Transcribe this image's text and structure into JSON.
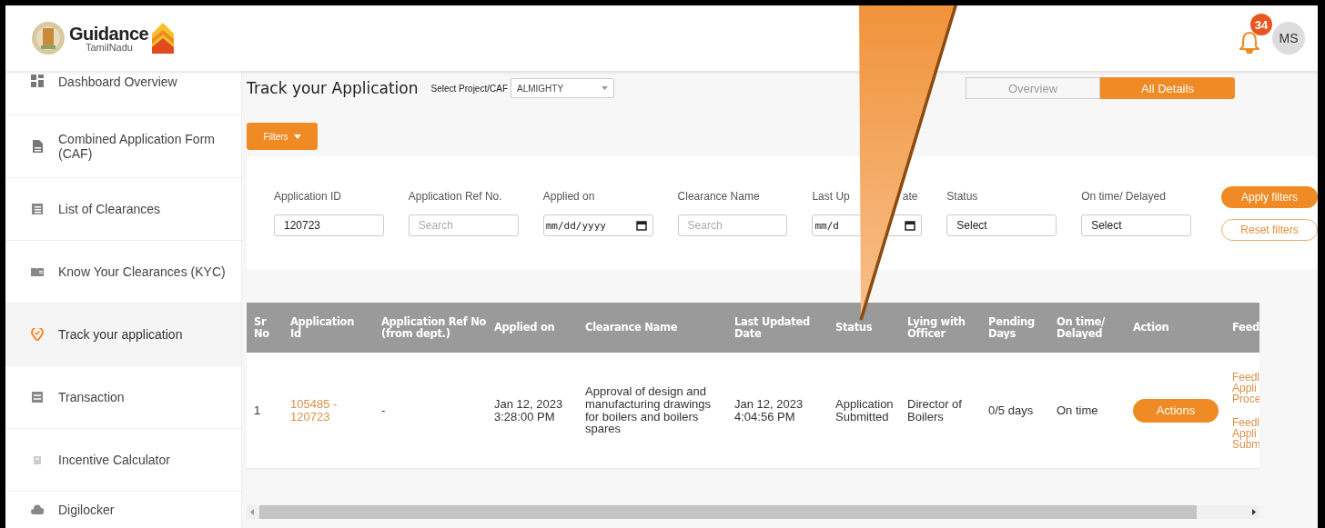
{
  "header": {
    "brand": "Guidance",
    "tagline": "TamilNadu",
    "notifications": "34",
    "avatar": "MS"
  },
  "sidebar": {
    "items": [
      {
        "label": "Dashboard Overview",
        "selected": false
      },
      {
        "label": "Combined Application Form (CAF)",
        "selected": false
      },
      {
        "label": "List of Clearances",
        "selected": false
      },
      {
        "label": "Know Your Clearances (KYC)",
        "selected": false
      },
      {
        "label": "Track your application",
        "selected": true
      },
      {
        "label": "Transaction",
        "selected": false
      },
      {
        "label": "Incentive Calculator",
        "selected": false
      },
      {
        "label": "Digilocker",
        "selected": false
      }
    ]
  },
  "page": {
    "title": "Track your Application",
    "project_select": {
      "label": "Select Project/CAF",
      "value": "ALMIGHTY"
    },
    "view_tabs": [
      {
        "label": "Overview",
        "selected": false
      },
      {
        "label": "All Details",
        "selected": true
      }
    ],
    "filters_button": "Filters",
    "filters": [
      {
        "kind": "text",
        "label": "Application ID",
        "value": "120723"
      },
      {
        "kind": "text",
        "label": "Application Ref No.",
        "placeholder": "Search"
      },
      {
        "kind": "date",
        "label": "Applied on",
        "placeholder": "mm/dd/yyyy"
      },
      {
        "kind": "text",
        "label": "Clearance Name",
        "placeholder": "Search"
      },
      {
        "kind": "date",
        "label_parts": [
          "Last Up",
          "ate"
        ],
        "placeholder": "mm/d"
      },
      {
        "kind": "select",
        "label": "Status",
        "value": "Select"
      },
      {
        "kind": "select",
        "label": "On time/ Delayed",
        "value": "Select"
      }
    ],
    "apply_button": "Apply filters",
    "reset_button": "Reset filters"
  },
  "table": {
    "columns": [
      "Sr No",
      "Application Id",
      "Application Ref No (from dept.)",
      "Applied on",
      "Clearance Name",
      "Last Updated Date",
      "Status",
      "Lying with Officer",
      "Pending Days",
      "On time/ Delayed",
      "Action",
      "Feed"
    ],
    "rows": [
      {
        "sr_no": "1",
        "application_id": "105485 - 120723",
        "ref_no": "-",
        "applied_on": "Jan 12, 2023 3:28:00 PM",
        "clearance_name": "Approval of design and manufacturing drawings for boilers and boilers spares",
        "last_updated": "Jan 12, 2023 4:04:56 PM",
        "status": "Application Submitted",
        "officer": "Director of Boilers",
        "pending_days": "0/5 days",
        "on_time": "On time",
        "action": "Actions",
        "feedback": [
          "Feedl Appli Proce",
          "Feedl Appli Subm"
        ]
      }
    ]
  }
}
